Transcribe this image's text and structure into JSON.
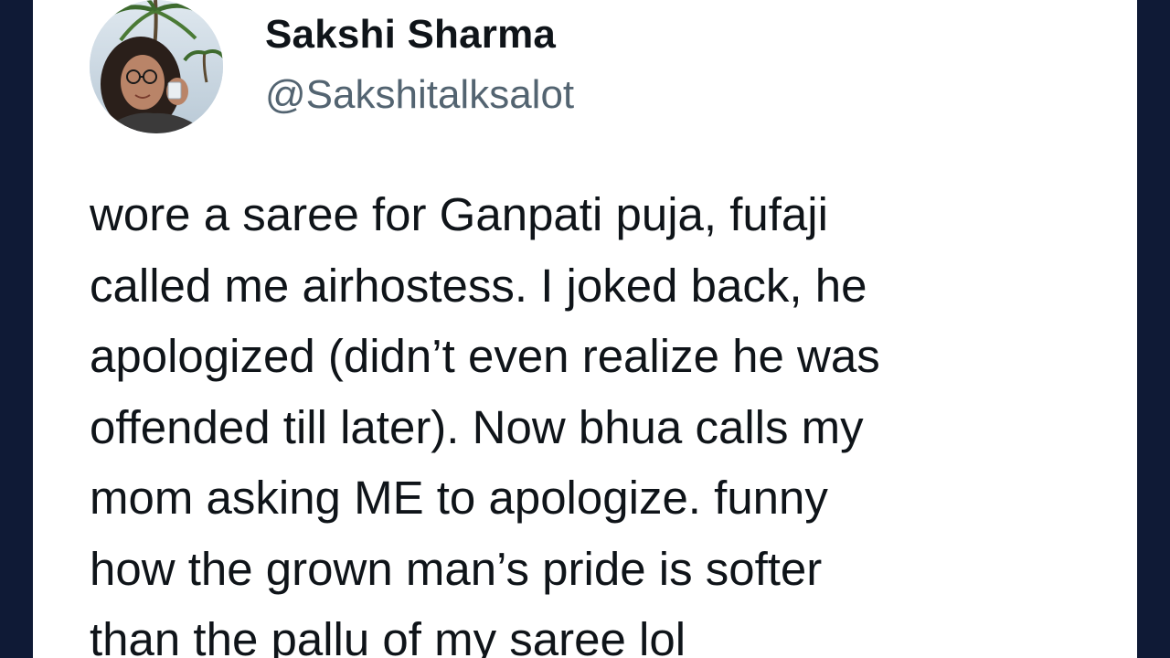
{
  "tweet": {
    "author": {
      "display_name": "Sakshi Sharma",
      "handle": "@Sakshitalksalot",
      "avatar_icon": "profile-photo"
    },
    "lines": [
      "wore a saree for Ganpati puja, fufaji",
      "called me airhostess. I joked back, he",
      "apologized (didn’t even realize he was",
      "offended till later). Now bhua calls my",
      "mom asking ME to apologize. funny",
      "how the grown man’s pride is softer",
      "than the pallu of my saree lol"
    ]
  },
  "colors": {
    "background": "#0f1a36",
    "card": "#ffffff",
    "text": "#0f1419",
    "handle": "#536471"
  }
}
